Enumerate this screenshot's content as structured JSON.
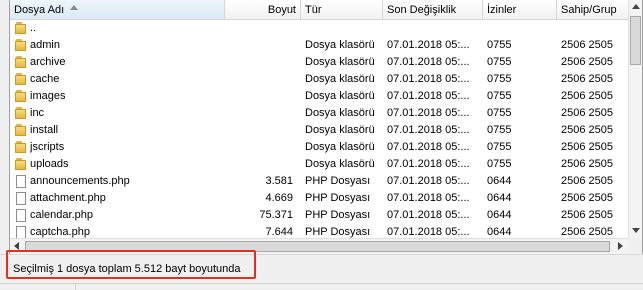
{
  "columns": {
    "name": "Dosya Adı",
    "size": "Boyut",
    "type": "Tür",
    "modified": "Son Değişiklik",
    "perms": "İzinler",
    "owner": "Sahip/Grup"
  },
  "rows": [
    {
      "name": "..",
      "icon": "folder-icon",
      "size": "",
      "type": "",
      "modified": "",
      "perms": "",
      "owner": ""
    },
    {
      "name": "admin",
      "icon": "folder-icon",
      "size": "",
      "type": "Dosya klasörü",
      "modified": "07.01.2018 05:...",
      "perms": "0755",
      "owner": "2506 2505"
    },
    {
      "name": "archive",
      "icon": "folder-icon",
      "size": "",
      "type": "Dosya klasörü",
      "modified": "07.01.2018 05:...",
      "perms": "0755",
      "owner": "2506 2505"
    },
    {
      "name": "cache",
      "icon": "folder-icon",
      "size": "",
      "type": "Dosya klasörü",
      "modified": "07.01.2018 05:...",
      "perms": "0755",
      "owner": "2506 2505"
    },
    {
      "name": "images",
      "icon": "folder-icon",
      "size": "",
      "type": "Dosya klasörü",
      "modified": "07.01.2018 05:...",
      "perms": "0755",
      "owner": "2506 2505"
    },
    {
      "name": "inc",
      "icon": "folder-icon",
      "size": "",
      "type": "Dosya klasörü",
      "modified": "07.01.2018 05:...",
      "perms": "0755",
      "owner": "2506 2505"
    },
    {
      "name": "install",
      "icon": "folder-icon",
      "size": "",
      "type": "Dosya klasörü",
      "modified": "07.01.2018 05:...",
      "perms": "0755",
      "owner": "2506 2505"
    },
    {
      "name": "jscripts",
      "icon": "folder-icon",
      "size": "",
      "type": "Dosya klasörü",
      "modified": "07.01.2018 05:...",
      "perms": "0755",
      "owner": "2506 2505"
    },
    {
      "name": "uploads",
      "icon": "folder-icon",
      "size": "",
      "type": "Dosya klasörü",
      "modified": "07.01.2018 05:...",
      "perms": "0755",
      "owner": "2506 2505"
    },
    {
      "name": "announcements.php",
      "icon": "file-icon",
      "size": "3.581",
      "type": "PHP Dosyası",
      "modified": "07.01.2018 05:...",
      "perms": "0644",
      "owner": "2506 2505"
    },
    {
      "name": "attachment.php",
      "icon": "file-icon",
      "size": "4.669",
      "type": "PHP Dosyası",
      "modified": "07.01.2018 05:...",
      "perms": "0644",
      "owner": "2506 2505"
    },
    {
      "name": "calendar.php",
      "icon": "file-icon",
      "size": "75.371",
      "type": "PHP Dosyası",
      "modified": "07.01.2018 05:...",
      "perms": "0644",
      "owner": "2506 2505"
    },
    {
      "name": "captcha.php",
      "icon": "file-icon",
      "size": "7.644",
      "type": "PHP Dosyası",
      "modified": "07.01.2018 05:...",
      "perms": "0644",
      "owner": "2506 2505"
    }
  ],
  "status": {
    "text": "Seçilmiş 1 dosya toplam 5.512 bayt boyutunda"
  },
  "colors": {
    "highlight_border": "#e0321f"
  }
}
